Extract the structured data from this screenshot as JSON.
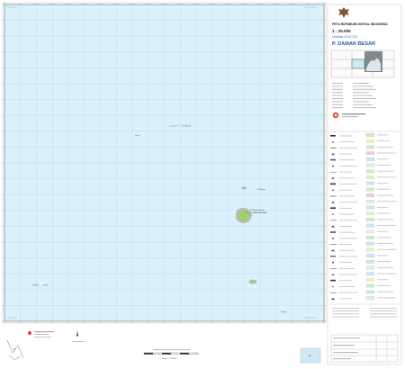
{
  "colors": {
    "sea": "#d9f2fb",
    "grid": "#a9d6ea",
    "frame": "#6a6a6a",
    "island_green": "#9bd36b",
    "island_grey": "#b9b9b9",
    "legend_sea": "#c6e8f6",
    "legend_green": "#cdeec0",
    "legend_yellow": "#eef4b5",
    "legend_pink": "#f2c9dc"
  },
  "icons": {
    "emblem": "garuda-emblem-icon",
    "inset": "locator-inset-map-icon",
    "north": "north-arrow-icon"
  },
  "map": {
    "sea_label": "LAUT JAWA",
    "islands": [
      {
        "name": "P. Damar Besar",
        "label": "P. Damar Besar",
        "label2": "P. DAMAR BESAR"
      },
      {
        "name": "P. Damar",
        "label": "P. Damar",
        "label2": ""
      }
    ]
  },
  "title_block": {
    "series": "PETA RUPABUMI DIGITAL INDONESIA",
    "scale": "1 : 25.000",
    "sheet_prefix": "Lembar",
    "sheet_number": "1210-121",
    "sheet_name": "P. DAMAR BESAR"
  },
  "footer": {
    "scale_bar_label": "Skala 1 : 25.000"
  }
}
